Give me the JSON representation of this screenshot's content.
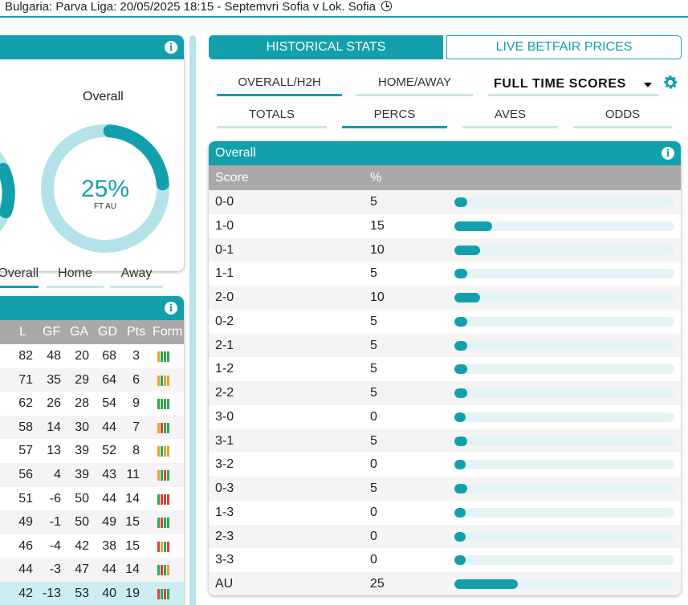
{
  "header": {
    "title": "Bulgaria: Parva Liga: 20/05/2025 18:15 - Septemvri Sofia v Lok. Sofia"
  },
  "donut": {
    "label": "Overall",
    "value_text": "25%",
    "sub": "FT AU",
    "fraction": 0.25
  },
  "left_tabs": [
    {
      "label": "Overall",
      "active": true
    },
    {
      "label": "Home",
      "active": false
    },
    {
      "label": "Away",
      "active": false
    }
  ],
  "league_table": {
    "columns": [
      "L",
      "GF",
      "GA",
      "GD",
      "Pts",
      "Form"
    ],
    "rows": [
      {
        "prefix": "",
        "l": "3",
        "gf": "68",
        "ga": "20",
        "gd": "48",
        "pts": "82",
        "form": [
          "#e8a13a",
          "#2fa84f",
          "#2fa84f",
          "#2fa84f"
        ]
      },
      {
        "prefix": "",
        "l": "6",
        "gf": "64",
        "ga": "29",
        "gd": "35",
        "pts": "71",
        "form": [
          "#e8a13a",
          "#2fa84f",
          "#e8a13a",
          "#e8a13a"
        ]
      },
      {
        "prefix": "",
        "l": "9",
        "gf": "54",
        "ga": "28",
        "gd": "26",
        "pts": "62",
        "form": [
          "#2fa84f",
          "#2fa84f",
          "#2fa84f",
          "#2fa84f"
        ]
      },
      {
        "prefix": "8",
        "l": "7",
        "gf": "44",
        "ga": "30",
        "gd": "14",
        "pts": "58",
        "form": [
          "#e8a13a",
          "#d9413a",
          "#2fa84f",
          "#2fa84f"
        ]
      },
      {
        "prefix": "2",
        "l": "8",
        "gf": "52",
        "ga": "39",
        "gd": "13",
        "pts": "57",
        "form": [
          "#e8a13a",
          "#2fa84f",
          "#e8a13a",
          "#e8a13a"
        ]
      },
      {
        "prefix": "",
        "l": "11",
        "gf": "43",
        "ga": "39",
        "gd": "4",
        "pts": "56",
        "form": [
          "#e8a13a",
          "#2fa84f",
          "#d9413a",
          "#2fa84f"
        ]
      },
      {
        "prefix": "",
        "l": "14",
        "gf": "44",
        "ga": "50",
        "gd": "-6",
        "pts": "51",
        "form": [
          "#2fa84f",
          "#d9413a",
          "#d9413a",
          "#d9413a"
        ]
      },
      {
        "prefix": "",
        "l": "15",
        "gf": "49",
        "ga": "50",
        "gd": "-1",
        "pts": "49",
        "form": [
          "#2fa84f",
          "#d9413a",
          "#2fa84f",
          "#2fa84f"
        ]
      },
      {
        "prefix": "",
        "l": "15",
        "gf": "38",
        "ga": "42",
        "gd": "-4",
        "pts": "46",
        "form": [
          "#d9413a",
          "#e8a13a",
          "#2fa84f",
          "#d9413a"
        ]
      },
      {
        "prefix": "",
        "l": "14",
        "gf": "44",
        "ga": "47",
        "gd": "-3",
        "pts": "44",
        "form": [
          "#2fa84f",
          "#d9413a",
          "#2fa84f",
          "#e8a13a"
        ]
      },
      {
        "prefix": "",
        "l": "19",
        "gf": "40",
        "ga": "53",
        "gd": "-13",
        "pts": "42",
        "form": [
          "#d9413a",
          "#2fa84f",
          "#d9413a",
          "#2fa84f"
        ],
        "highlight": true
      }
    ]
  },
  "right_top_buttons": {
    "historical": "HISTORICAL STATS",
    "live": "LIVE BETFAIR PRICES"
  },
  "right_tabs_row1": [
    {
      "label": "OVERALL/H2H",
      "active": true
    },
    {
      "label": "HOME/AWAY",
      "active": false
    }
  ],
  "dropdown": {
    "value": "FULL TIME SCORES"
  },
  "right_tabs_row2": [
    {
      "label": "TOTALS",
      "active": false
    },
    {
      "label": "PERCS",
      "active": true
    },
    {
      "label": "AVES",
      "active": false
    },
    {
      "label": "ODDS",
      "active": false
    }
  ],
  "scores_card": {
    "title": "Overall",
    "columns": [
      "Score",
      "%"
    ],
    "rows": [
      {
        "score": "0-0",
        "pct": 5
      },
      {
        "score": "1-0",
        "pct": 15
      },
      {
        "score": "0-1",
        "pct": 10
      },
      {
        "score": "1-1",
        "pct": 5
      },
      {
        "score": "2-0",
        "pct": 10
      },
      {
        "score": "0-2",
        "pct": 5
      },
      {
        "score": "2-1",
        "pct": 5
      },
      {
        "score": "1-2",
        "pct": 5
      },
      {
        "score": "2-2",
        "pct": 5
      },
      {
        "score": "3-0",
        "pct": 0
      },
      {
        "score": "3-1",
        "pct": 5
      },
      {
        "score": "3-2",
        "pct": 0
      },
      {
        "score": "0-3",
        "pct": 5
      },
      {
        "score": "1-3",
        "pct": 0
      },
      {
        "score": "2-3",
        "pct": 0
      },
      {
        "score": "3-3",
        "pct": 0
      },
      {
        "score": "AU",
        "pct": 25
      }
    ]
  },
  "colors": {
    "accent": "#12a0ad",
    "track": "#e5f3f5",
    "header_grey": "#a9a9a9"
  }
}
